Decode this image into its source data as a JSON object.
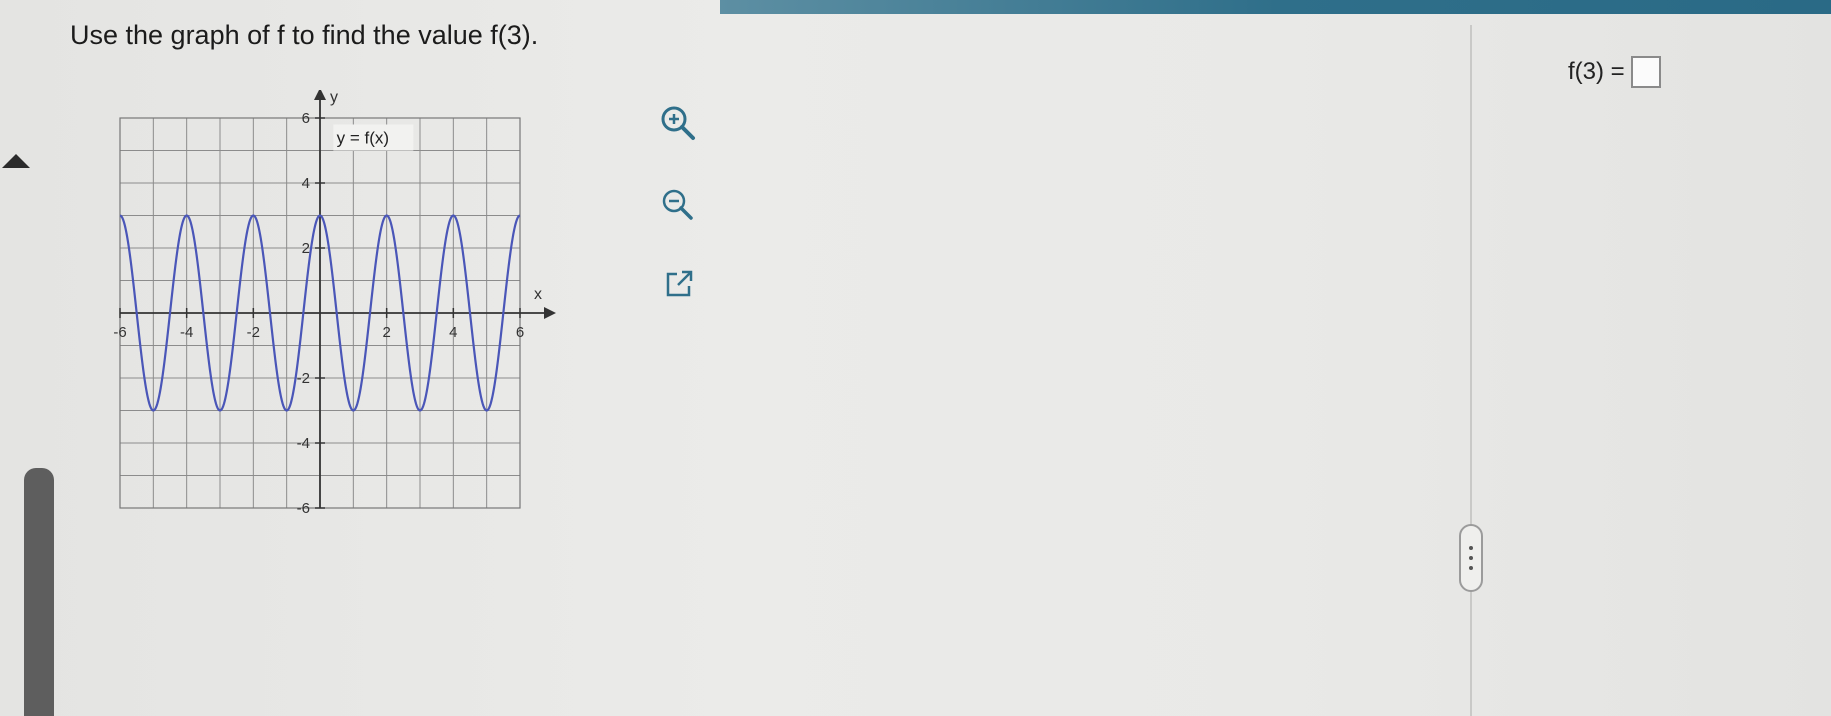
{
  "question": {
    "text": "Use the graph of f to find the value f(3)."
  },
  "answer": {
    "label": "f(3) =",
    "value": ""
  },
  "tools": {
    "zoom_in": "zoom-in-icon",
    "zoom_out": "zoom-out-icon",
    "popout": "external-link-icon"
  },
  "colors": {
    "curve": "#4a56b8",
    "grid": "#8c8c8c",
    "accent_strip": "#2f6f8a"
  },
  "chart_data": {
    "type": "line",
    "function_label": "y = f(x)",
    "xlabel": "x",
    "ylabel": "y",
    "xlim": [
      -6,
      6
    ],
    "ylim": [
      -6,
      6
    ],
    "grid": true,
    "x_tick_labels": [
      "-6",
      "-4",
      "-2",
      "2",
      "4",
      "6"
    ],
    "y_tick_labels": [
      "6",
      "4",
      "2",
      "-2",
      "-4",
      "-6"
    ],
    "series": [
      {
        "values_description_free": true,
        "x": [
          -6,
          -5.5,
          -5,
          -4.5,
          -4,
          -3.5,
          -3,
          -2.5,
          -2,
          -1.5,
          -1,
          -0.5,
          0,
          0.5,
          1,
          1.5,
          2,
          2.5,
          3,
          3.5,
          4,
          4.5,
          5,
          5.5,
          6
        ],
        "y": [
          3,
          0,
          -3,
          0,
          3,
          0,
          -3,
          0,
          3,
          0,
          -3,
          0,
          3,
          0,
          -3,
          0,
          3,
          0,
          -3,
          0,
          3,
          0,
          -3,
          0,
          3
        ]
      }
    ]
  }
}
